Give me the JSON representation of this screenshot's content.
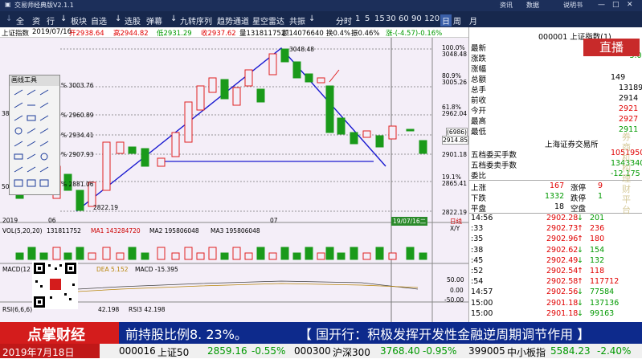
{
  "titlebar": {
    "app_title": "交易师经典版V2.1.1",
    "right_items": [
      "资讯",
      "数据",
      "说明书"
    ],
    "min": "—",
    "max": "□",
    "close": "✕"
  },
  "menubar": {
    "items": [
      "↓",
      "全",
      "资",
      "行",
      "↓",
      "板块",
      "自选",
      "↓",
      "选股",
      "弹幕",
      "↓",
      "九转序列",
      "趋势通道",
      "星空雷达",
      "共振",
      "↓",
      "分时",
      "1",
      "5",
      "15",
      "30",
      "60",
      "90",
      "120",
      "日",
      "周",
      "月"
    ]
  },
  "infobar": {
    "index_name": "上证指数",
    "date": "2019/07/16",
    "open": "开2938.64",
    "high": "高2944.82",
    "low": "低2931.29",
    "close": "收2937.62",
    "vol": "量131811752",
    "amount": "额14076640",
    "turnover": "换0.4%",
    "amplitude": "振0.46%",
    "change": "涨-(-4.57)-0.16%"
  },
  "chart": {
    "y_right_labels": [
      "100.0%",
      "3048.48",
      "80.9%",
      "3005.26",
      "61.8%",
      "2962.04",
      "50.0%",
      "38.2%",
      "2918.65",
      "23.6%",
      "2901.18",
      "19.1%",
      "2865.41",
      "0.0%",
      "2822.19"
    ],
    "fib_left_labels": [
      "% 3003.76",
      "% 2960.89",
      "% 2934.41",
      "% 2907.93",
      "% 2881.06"
    ],
    "peak_label": "3048.48",
    "low_label": "2822.19",
    "price_tag_top": "(6986)",
    "price_tag": "2914.85",
    "date_tag": "19/07/16二",
    "months": [
      "2019",
      "06",
      "07"
    ],
    "side_labels": [
      "38",
      "50"
    ],
    "day_label": "日线",
    "xy_label": "X/Y"
  },
  "vol": {
    "title": "VOL(5,20,20)",
    "v": "131811752",
    "ma1": "MA1 143284720",
    "ma2": "MA2 195806048",
    "ma3": "MA3 195806048"
  },
  "macd": {
    "title": "MACD(12",
    "dea": "DEA 5.152",
    "macd": "MACD -15.395",
    "ax": [
      "50.00",
      "0.00",
      "-50.00"
    ]
  },
  "rsi": {
    "title": "RSI(6,6,6)",
    "rsi2": "42.198",
    "rsi3": "RSI3 42.198"
  },
  "toolbox": {
    "title": "画线工具"
  },
  "ticker": {
    "logo": "点掌财经",
    "msg1": "前持股比例8. 23%。",
    "msg2": "【 国开行：积极发挥开发性金融逆周期调节作用 】"
  },
  "bottombar": {
    "date": "2019年7月18日",
    "quotes": [
      {
        "code": "000016",
        "name": "上证50",
        "price": "2859.16",
        "chg": "-0.55%"
      },
      {
        "code": "000300",
        "name": "沪深300",
        "price": "3768.40",
        "chg": "-0.95%"
      },
      {
        "code": "399005",
        "name": "中小板指",
        "price": "5584.23",
        "chg": "-2.40%"
      }
    ]
  },
  "rightpanel": {
    "code_name": "000001 上证指数(1)",
    "live": "直播",
    "rows": [
      {
        "k": "最新",
        "v": "-3.05"
      },
      {
        "k": "涨跌",
        "v": ""
      },
      {
        "k": "涨幅",
        "v": ""
      },
      {
        "k": "总额",
        "v": "149"
      },
      {
        "k": "总手",
        "v": "13189"
      },
      {
        "k": "前收",
        "v": "2914"
      },
      {
        "k": "今开",
        "v": "2921"
      },
      {
        "k": "最高",
        "v": "2927"
      },
      {
        "k": "最低",
        "v": "2911"
      }
    ],
    "exchange": "上海证券交易所",
    "order_rows": [
      {
        "k": "五档委买手数",
        "v": "1051950"
      },
      {
        "k": "五档委卖手数",
        "v": "1343340"
      },
      {
        "k": "委比",
        "v": "-12.175"
      }
    ],
    "updown": [
      {
        "k": "上涨",
        "n": "167",
        "k2": "涨停",
        "v": "9"
      },
      {
        "k": "下跌",
        "n": "1332",
        "k2": "跌停",
        "v": "1"
      },
      {
        "k": "平盘",
        "n": "18",
        "k2": "空盘",
        "v": ""
      }
    ],
    "ticks": [
      {
        "t": "14:56",
        "p": "2902.28",
        "d": "↓",
        "v": "201"
      },
      {
        "t": ":33",
        "p": "2902.73",
        "d": "↑",
        "v": "236"
      },
      {
        "t": ":35",
        "p": "2902.96",
        "d": "↑",
        "v": "180"
      },
      {
        "t": ":38",
        "p": "2902.62",
        "d": "↓",
        "v": "154"
      },
      {
        "t": ":45",
        "p": "2902.49",
        "d": "↓",
        "v": "132"
      },
      {
        "t": ":52",
        "p": "2902.54",
        "d": "↑",
        "v": "118"
      },
      {
        "t": ":54",
        "p": "2902.58",
        "d": "↑",
        "v": "117712"
      },
      {
        "t": "14:57",
        "p": "2902.56",
        "d": "↓",
        "v": "77584"
      },
      {
        "t": "15:00",
        "p": "2901.18",
        "d": "↓",
        "v": "137136"
      },
      {
        "t": "15:00",
        "p": "2901.18",
        "d": "↓",
        "v": "99163"
      }
    ],
    "watermark": "券商机构理财平台"
  }
}
